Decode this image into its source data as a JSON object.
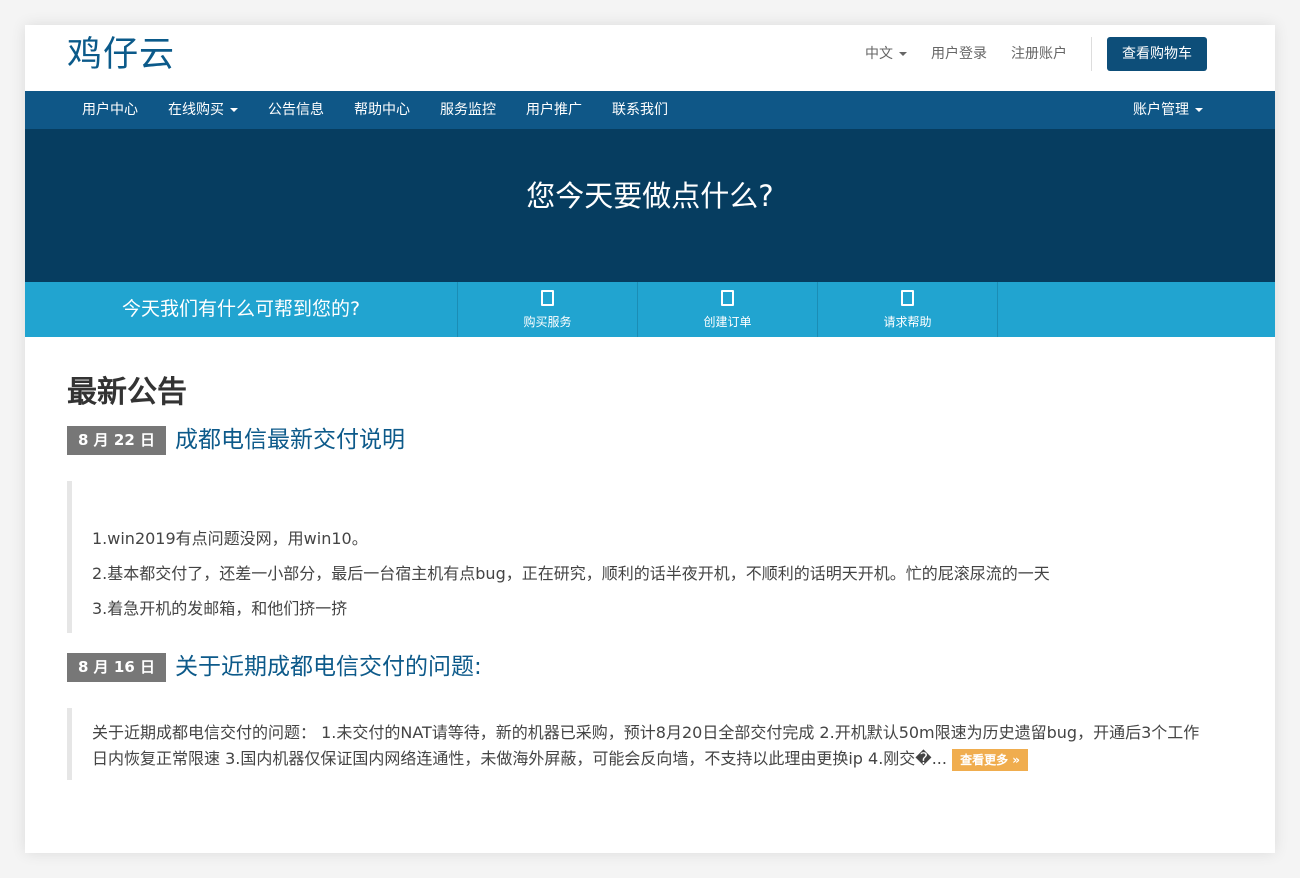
{
  "logo": "鸡仔云",
  "top_links": {
    "language": "中文",
    "login": "用户登录",
    "register": "注册账户",
    "cart": "查看购物车"
  },
  "nav": {
    "items": [
      {
        "label": "用户中心"
      },
      {
        "label": "在线购买",
        "dropdown": true
      },
      {
        "label": "公告信息"
      },
      {
        "label": "帮助中心"
      },
      {
        "label": "服务监控"
      },
      {
        "label": "用户推广"
      },
      {
        "label": "联系我们"
      }
    ],
    "account": "账户管理"
  },
  "hero": {
    "title": "您今天要做点什么?"
  },
  "helpbar": {
    "text": "今天我们有什么可帮到您的?",
    "actions": [
      {
        "label": "购买服务",
        "icon": "document-icon"
      },
      {
        "label": "创建订单",
        "icon": "document-icon"
      },
      {
        "label": "请求帮助",
        "icon": "document-icon"
      }
    ]
  },
  "announcements": {
    "title": "最新公告",
    "items": [
      {
        "date": "8 月 22 日",
        "title": "成都电信最新交付说明",
        "lines": [
          "1.win2019有点问题没网，用win10。",
          "2.基本都交付了，还差一小部分，最后一台宿主机有点bug，正在研究，顺利的话半夜开机，不顺利的话明天开机。忙的屁滚尿流的一天",
          "3.着急开机的发邮箱，和他们挤一挤"
        ]
      },
      {
        "date": "8 月 16 日",
        "title": "关于近期成都电信交付的问题:",
        "excerpt": "关于近期成都电信交付的问题： 1.未交付的NAT请等待，新的机器已采购，预计8月20日全部交付完成 2.开机默认50m限速为历史遗留bug，开通后3个工作日内恢复正常限速 3.国内机器仅保证国内网络连通性，未做海外屏蔽，可能会反向墙，不支持以此理由更换ip 4.刚交�...",
        "more": "查看更多 »"
      }
    ]
  },
  "colors": {
    "brand": "#0b5a8a",
    "nav_bg": "#0f5787",
    "hero_bg": "#063d60",
    "helpbar_bg": "#21a4d0",
    "date_badge": "#777777",
    "more_button": "#f0ad4e"
  }
}
